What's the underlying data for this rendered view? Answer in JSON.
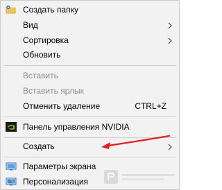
{
  "menu": {
    "items": [
      {
        "label": "Создать папку"
      },
      {
        "label": "Вид"
      },
      {
        "label": "Сортировка"
      },
      {
        "label": "Обновить"
      },
      {
        "label": "Вставить"
      },
      {
        "label": "Вставить ярлык"
      },
      {
        "label": "Отменить удаление",
        "shortcut": "CTRL+Z"
      },
      {
        "label": "Панель управления NVIDIA"
      },
      {
        "label": "Создать"
      },
      {
        "label": "Параметры экрана"
      },
      {
        "label": "Персонализация"
      }
    ]
  },
  "colors": {
    "menu_background": "#f2f2f2",
    "disabled_text": "#8d8d8d",
    "annotation_arrow": "#e02020",
    "nvidia_green": "#76b900"
  },
  "icons": {
    "new_folder": "new-folder-icon",
    "submenu": "chevron-right-icon",
    "nvidia": "nvidia-logo-icon",
    "display": "display-icon",
    "personalize": "personalize-icon"
  }
}
